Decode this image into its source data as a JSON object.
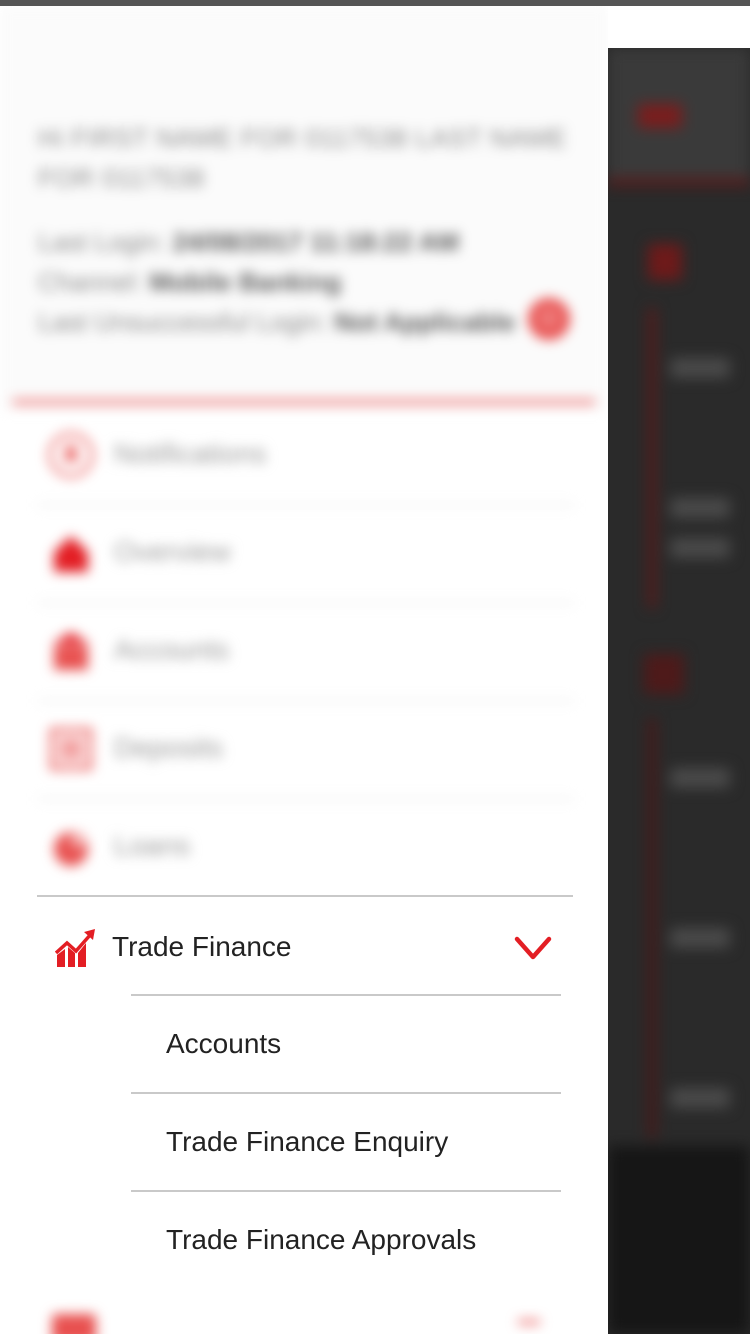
{
  "header": {
    "greeting": "Hi FIRST NAME FOR 0117538 LAST NAME FOR 0117538",
    "last_login_label": "Last Login:",
    "last_login_value": "24/08/2017 11:18:22 AM",
    "channel_label": "Channel:",
    "channel_value": "Mobile Banking",
    "unsuccessful_label": "Last Unsuccessful Login:",
    "unsuccessful_value": "Not Applicable"
  },
  "menu": {
    "items": [
      {
        "label": "Notifications",
        "icon": "bell-icon"
      },
      {
        "label": "Overview",
        "icon": "home-icon"
      },
      {
        "label": "Accounts",
        "icon": "bank-icon"
      },
      {
        "label": "Deposits",
        "icon": "deposit-icon"
      },
      {
        "label": "Loans",
        "icon": "loan-icon"
      }
    ],
    "trade_finance": {
      "label": "Trade Finance",
      "icon": "trend-chart-icon",
      "expanded": true,
      "subitems": [
        {
          "label": "Accounts"
        },
        {
          "label": "Trade Finance Enquiry"
        },
        {
          "label": "Trade Finance Approvals"
        }
      ]
    }
  },
  "colors": {
    "accent": "#e31e24",
    "accent_faded": "#ef8a8a",
    "overlay": "#2a2a2a"
  }
}
